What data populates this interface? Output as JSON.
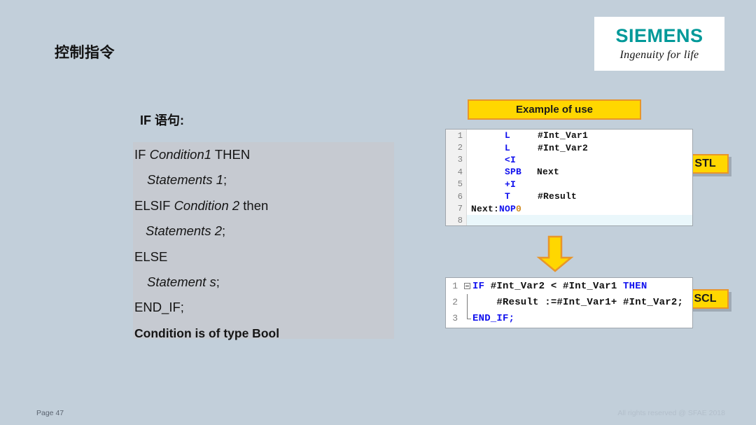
{
  "slide": {
    "title": "控制指令",
    "background_color": "#c2cfda"
  },
  "logo": {
    "wordmark": "SIEMENS",
    "claim": "Ingenuity for life",
    "wordmark_color": "#009999"
  },
  "if_syntax": {
    "heading": "IF 语句:",
    "lines": [
      {
        "prefix": "IF ",
        "em": "Condition1",
        "suffix": " THEN",
        "indent": 0,
        "bold": false
      },
      {
        "prefix": "",
        "em": "Statements 1",
        "suffix": ";",
        "indent": 1,
        "bold": false
      },
      {
        "prefix": "ELSIF ",
        "em": "Condition 2",
        "suffix": " then",
        "indent": 0,
        "bold": false
      },
      {
        "prefix": "",
        "em": "Statements 2",
        "suffix": ";",
        "indent": 2,
        "bold": false
      },
      {
        "prefix": "ELSE",
        "em": "",
        "suffix": "",
        "indent": 0,
        "bold": false
      },
      {
        "prefix": "",
        "em": "Statement s",
        "suffix": ";",
        "indent": 1,
        "bold": false
      },
      {
        "prefix": "END_IF;",
        "em": "",
        "suffix": "",
        "indent": 0,
        "bold": false
      },
      {
        "prefix": "Condition is of type Bool",
        "em": "",
        "suffix": "",
        "indent": 0,
        "bold": true
      }
    ]
  },
  "callouts": {
    "example_of_use": "Example of use",
    "stl_tag": "STL",
    "scl_tag": "SCL",
    "box_fill": "#ffd700",
    "box_border": "#e8962a"
  },
  "stl_code": {
    "lines": [
      {
        "n": "1",
        "label": "",
        "op": "L",
        "arg": "#Int_Var1",
        "num": "",
        "active": false
      },
      {
        "n": "2",
        "label": "",
        "op": "L",
        "arg": "#Int_Var2",
        "num": "",
        "active": false
      },
      {
        "n": "3",
        "label": "",
        "op": "<I",
        "arg": "",
        "num": "",
        "active": false
      },
      {
        "n": "4",
        "label": "",
        "op": "SPB",
        "arg": "Next",
        "num": "",
        "active": false
      },
      {
        "n": "5",
        "label": "",
        "op": "+I",
        "arg": "",
        "num": "",
        "active": false
      },
      {
        "n": "6",
        "label": "",
        "op": "T",
        "arg": "#Result",
        "num": "",
        "active": false
      },
      {
        "n": "7",
        "label": "Next:",
        "op": "NOP",
        "arg": "",
        "num": "0",
        "active": false
      },
      {
        "n": "8",
        "label": "",
        "op": "",
        "arg": "",
        "num": "",
        "active": true
      }
    ]
  },
  "scl_code": {
    "lines": [
      {
        "n": "1",
        "fold": "start",
        "kw_start": "IF",
        "body": " #Int_Var2 < #Int_Var1 ",
        "kw_end": "THEN"
      },
      {
        "n": "2",
        "fold": "mid",
        "kw_start": "",
        "body": "    #Result :=#Int_Var1+ #Int_Var2;",
        "kw_end": ""
      },
      {
        "n": "3",
        "fold": "end",
        "kw_start": "END_IF;",
        "body": "",
        "kw_end": ""
      }
    ]
  },
  "footer": {
    "page": "Page 47",
    "copyright": "All rights reserved @ SFAE 2018"
  }
}
